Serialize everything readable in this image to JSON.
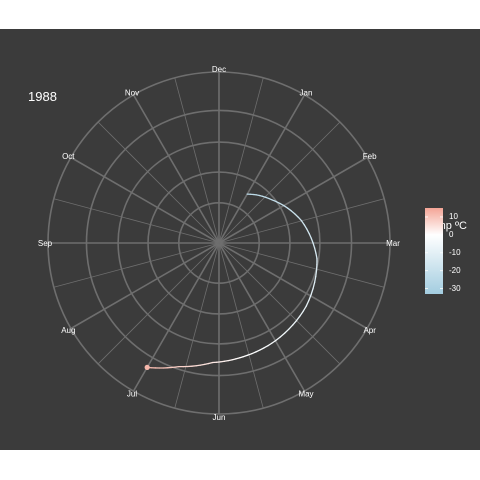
{
  "year_label": "1988",
  "chart_data": {
    "type": "line",
    "coordinate_system": "polar",
    "angular_axis": {
      "categories": [
        "Jan",
        "Feb",
        "Mar",
        "Apr",
        "May",
        "Jun",
        "Jul",
        "Aug",
        "Sep",
        "Oct",
        "Nov",
        "Dec"
      ]
    },
    "radial_axis": {
      "tick_labels_shown": false,
      "rings": 5
    },
    "series": [
      {
        "points": [
          {
            "month": 0.0,
            "r": 0.33,
            "temp": -25
          },
          {
            "month": 0.7,
            "r": 0.4,
            "temp": -22
          },
          {
            "month": 1.5,
            "r": 0.5,
            "temp": -18
          },
          {
            "month": 2.3,
            "r": 0.58,
            "temp": -14
          },
          {
            "month": 3.2,
            "r": 0.63,
            "temp": -9
          },
          {
            "month": 4.0,
            "r": 0.66,
            "temp": -4
          },
          {
            "month": 4.6,
            "r": 0.68,
            "temp": 0
          },
          {
            "month": 5.1,
            "r": 0.7,
            "temp": 4
          },
          {
            "month": 5.6,
            "r": 0.76,
            "temp": 8
          },
          {
            "month": 6.0,
            "r": 0.84,
            "temp": 12
          }
        ]
      }
    ],
    "colorbar": {
      "title": "Temp ºC",
      "ticks": [
        10,
        0,
        -10,
        -20,
        -30
      ],
      "range": [
        -33,
        15
      ],
      "colors": {
        "high": "#f4a596",
        "mid": "#ffffff",
        "low": "#a3cde0"
      }
    },
    "grid": true
  }
}
